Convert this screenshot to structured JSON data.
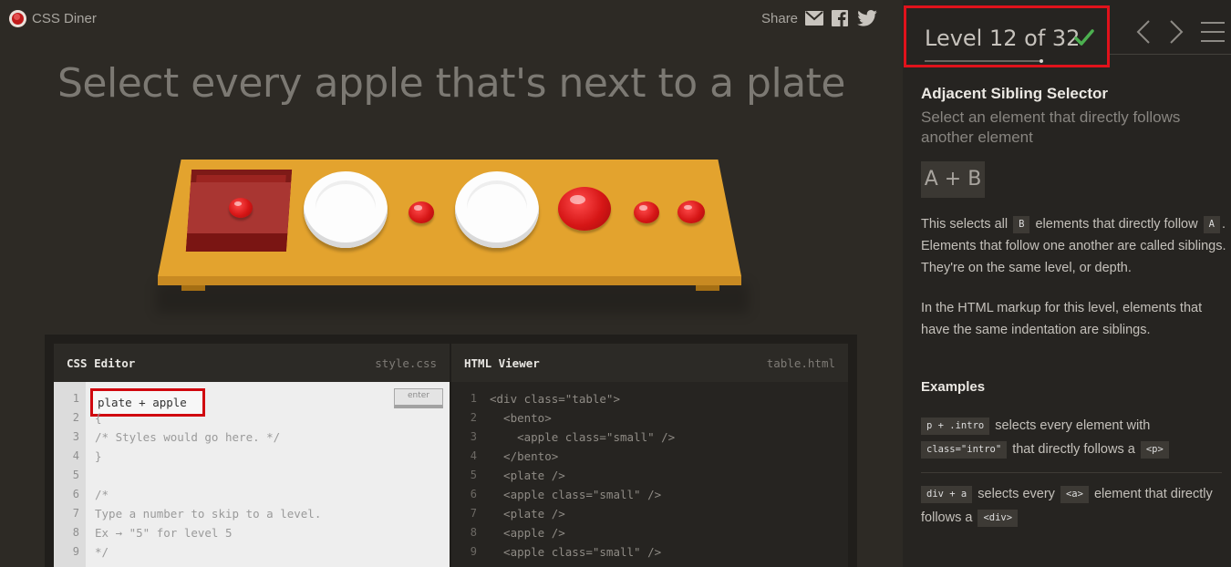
{
  "app": {
    "logo_text": "CSS Diner"
  },
  "share": {
    "label": "Share"
  },
  "instruction": "Select every apple that's next to a plate",
  "editor": {
    "css_title": "CSS Editor",
    "css_file": "style.css",
    "css_input_value": "plate + apple",
    "enter_label": "enter",
    "css_lines": [
      "{",
      "/* Styles would go here. */",
      "}",
      "",
      "/*",
      "Type a number to skip to a level.",
      "Ex → \"5\" for level 5",
      "*/"
    ],
    "css_line_numbers": [
      "1",
      "2",
      "3",
      "4",
      "5",
      "6",
      "7",
      "8",
      "9"
    ],
    "html_title": "HTML Viewer",
    "html_file": "table.html",
    "html_lines": [
      "<div class=\"table\">",
      "  <bento>",
      "    <apple class=\"small\" />",
      "  </bento>",
      "  <plate />",
      "  <apple class=\"small\" />",
      "  <plate />",
      "  <apple />",
      "  <apple class=\"small\" />"
    ],
    "html_line_numbers": [
      "1",
      "2",
      "3",
      "4",
      "5",
      "6",
      "7",
      "8",
      "9"
    ]
  },
  "level": {
    "label": "Level 12 of 32",
    "current": 12,
    "total": 32,
    "completed": true,
    "check_color": "#4cb050",
    "highlight_color": "#e0121b"
  },
  "nav": {
    "prev_icon": "chevron-left-icon",
    "next_icon": "chevron-right-icon",
    "menu_icon": "hamburger-menu-icon"
  },
  "sidebar": {
    "title": "Adjacent Sibling Selector",
    "subtitle": "Select an element that directly follows another element",
    "syntax": "A + B",
    "p1_a": "This selects all",
    "p1_chip_b": "B",
    "p1_b": "elements that directly follow",
    "p1_chip_a": "A",
    "p1_c": ". Elements that follow one another are called siblings. They're on the same level, or depth.",
    "p2": "In the HTML markup for this level, elements that have the same indentation are siblings.",
    "examples_title": "Examples",
    "ex1_chip1": "p + .intro",
    "ex1_a": "selects every element with",
    "ex1_chip2": "class=\"intro\"",
    "ex1_b": "that directly follows a",
    "ex1_chip3": "<p>",
    "ex2_chip1": "div + a",
    "ex2_a": "selects every",
    "ex2_chip2": "<a>",
    "ex2_b": "element that directly follows a",
    "ex2_chip3": "<div>"
  },
  "colors": {
    "table": "#e3a32e",
    "apple": "#d61616",
    "plate": "#fdfdfd",
    "bento": "#9c2420"
  }
}
